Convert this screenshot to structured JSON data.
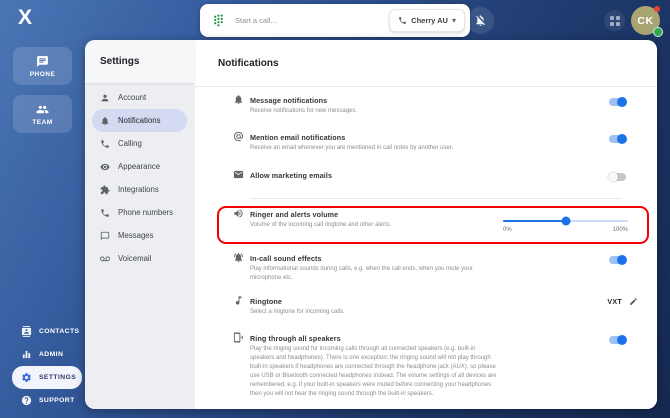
{
  "topbar": {
    "logo": "X",
    "call_placeholder": "Start a call...",
    "line_button": "Cherry AU",
    "avatar_initials": "CK"
  },
  "sidebar": {
    "primary": [
      {
        "label": "PHONE"
      },
      {
        "label": "TEAM"
      }
    ],
    "secondary": [
      {
        "label": "CONTACTS"
      },
      {
        "label": "ADMIN"
      },
      {
        "label": "SETTINGS",
        "active": true
      },
      {
        "label": "SUPPORT"
      }
    ]
  },
  "settings_nav": {
    "title": "Settings",
    "items": [
      {
        "label": "Account"
      },
      {
        "label": "Notifications",
        "active": true
      },
      {
        "label": "Calling"
      },
      {
        "label": "Appearance"
      },
      {
        "label": "Integrations"
      },
      {
        "label": "Phone numbers"
      },
      {
        "label": "Messages"
      },
      {
        "label": "Voicemail"
      }
    ]
  },
  "main": {
    "title": "Notifications",
    "rows": [
      {
        "title": "Message notifications",
        "desc": "Receive notifications for new messages.",
        "control": "toggle",
        "state": "on"
      },
      {
        "title": "Mention email notifications",
        "desc": "Receive an email whenever you are mentioned in call notes by another user.",
        "control": "toggle",
        "state": "on"
      },
      {
        "title": "Allow marketing emails",
        "desc": "",
        "control": "toggle",
        "state": "off"
      },
      {
        "title": "Ringer and alerts volume",
        "desc": "Volume of the incoming call ringtone and other alerts.",
        "control": "slider",
        "state": ""
      },
      {
        "title": "In-call sound effects",
        "desc": "Play informational sounds during calls, e.g. when the call ends, when you mute your microphone etc.",
        "control": "toggle",
        "state": "on"
      },
      {
        "title": "Ringtone",
        "desc": "Select a ringtone for incoming calls.",
        "control": "value",
        "value": "VXT",
        "state": ""
      },
      {
        "title": "Ring through all speakers",
        "desc": "Play the ringing sound for incoming calls through all connected speakers (e.g. built-in speakers and headphones). There is one exception: the ringing sound will not play through built-in speakers if headphones are connected through the headphone jack (AUX), so please use USB or Bluetooth connected headphones instead. The volume settings of all devices are remembered, e.g. if your built-in speakers were muted before connecting your headphones then you will not hear the ringing sound through the built-in speakers.",
        "control": "toggle",
        "state": "on"
      }
    ],
    "slider": {
      "value_pct": 50,
      "min_label": "0%",
      "max_label": "100%"
    },
    "highlight_color": "#f50000"
  },
  "colors": {
    "accent_blue": "#1a73e8",
    "dialpad_green": "#1e8e3e",
    "highlight_red": "#f50000",
    "avatar_olive": "#a8a573",
    "online_green": "#2fa84f"
  }
}
